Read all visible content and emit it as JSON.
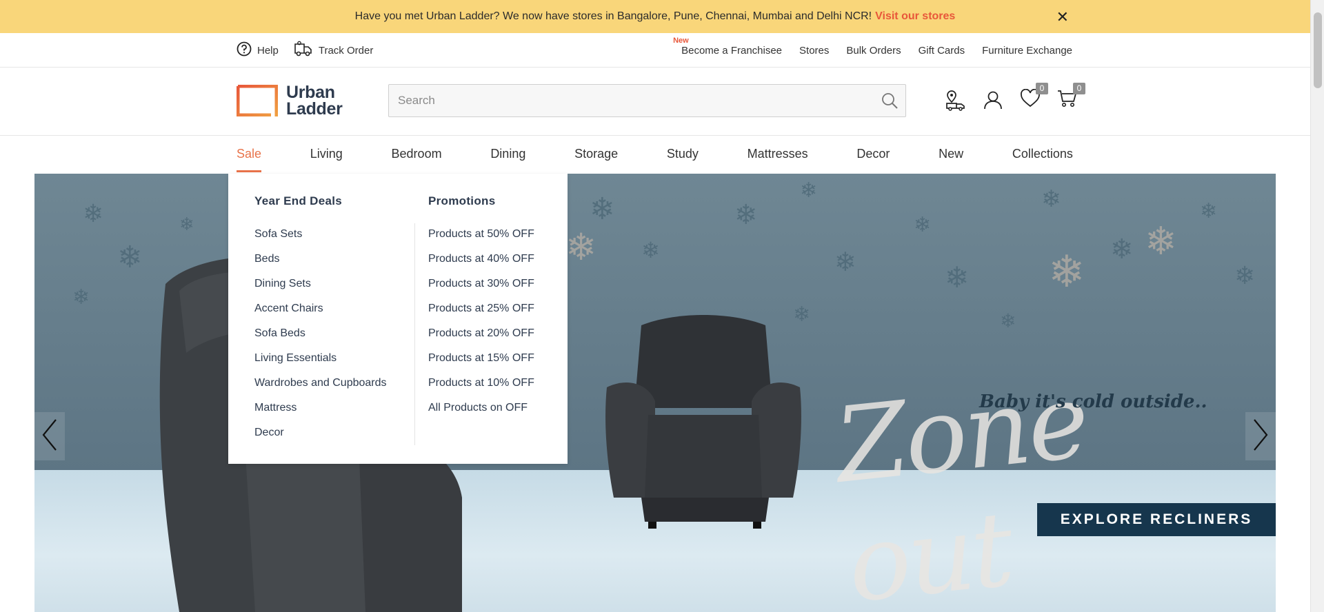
{
  "announcement": {
    "text": "Have you met Urban Ladder? We now have stores in Bangalore, Pune, Chennai, Mumbai and Delhi NCR!",
    "link": "Visit our stores",
    "close": "✕"
  },
  "utility": {
    "help": "Help",
    "track_order": "Track Order",
    "new_tag": "New",
    "links": [
      "Become a Franchisee",
      "Stores",
      "Bulk Orders",
      "Gift Cards",
      "Furniture Exchange"
    ]
  },
  "header": {
    "logo_line1": "Urban",
    "logo_line2": "Ladder",
    "search_placeholder": "Search",
    "wishlist_count": "0",
    "cart_count": "0"
  },
  "nav": {
    "items": [
      "Sale",
      "Living",
      "Bedroom",
      "Dining",
      "Storage",
      "Study",
      "Mattresses",
      "Decor",
      "New",
      "Collections"
    ],
    "active": "Sale"
  },
  "dropdown": {
    "left_title": "Year End Deals",
    "left_items": [
      "Sofa Sets",
      "Beds",
      "Dining Sets",
      "Accent Chairs",
      "Sofa Beds",
      "Living Essentials",
      "Wardrobes and Cupboards",
      "Mattress",
      "Decor"
    ],
    "right_title": "Promotions",
    "right_items": [
      "Products at 50% OFF",
      "Products at 40% OFF",
      "Products at 30% OFF",
      "Products at 25% OFF",
      "Products at 20% OFF",
      "Products at 15% OFF",
      "Products at 10% OFF",
      "All Products on OFF"
    ]
  },
  "hero": {
    "tagline": "Baby it's cold outside..",
    "script": "Zone out",
    "cta": "EXPLORE RECLINERS"
  },
  "colors": {
    "accent": "#e8734a",
    "banner": "#f9d67a",
    "link_red": "#e8573a",
    "brand_dark": "#2e3b4e",
    "cta_bg": "#16364d"
  },
  "icons": {
    "help": "help-circle-icon",
    "track": "truck-icon",
    "search": "search-icon",
    "store": "store-location-icon",
    "account": "user-icon",
    "wishlist": "heart-icon",
    "cart": "cart-icon",
    "prev": "chevron-left-icon",
    "next": "chevron-right-icon"
  }
}
